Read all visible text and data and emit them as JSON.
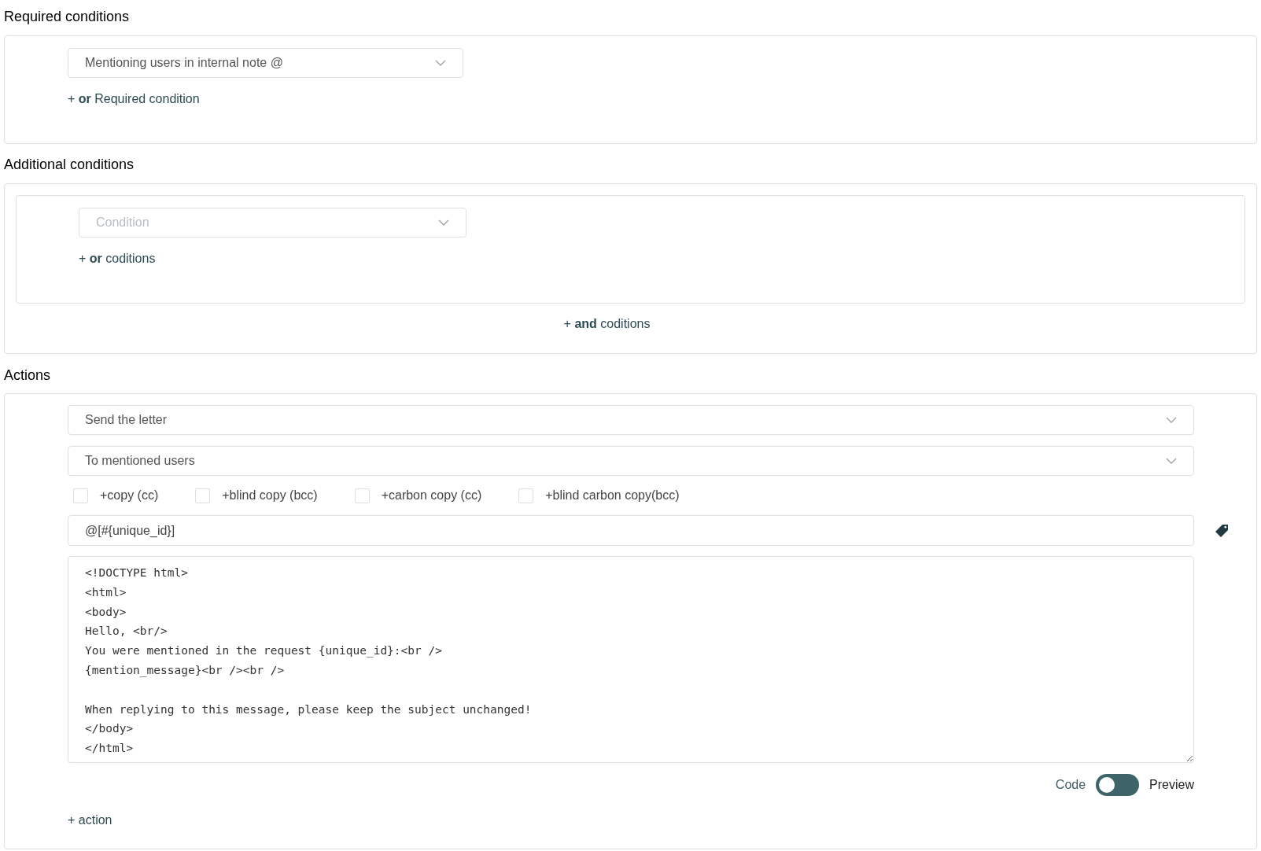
{
  "required_conditions": {
    "heading": "Required conditions",
    "select": {
      "value": "Mentioning users in internal note @"
    },
    "add_link": "+ **or** Required condition"
  },
  "additional_conditions": {
    "heading": "Additional conditions",
    "select": {
      "placeholder": "Condition"
    },
    "or_link": "+ **or** coditions",
    "and_link": "+ **and** coditions"
  },
  "actions": {
    "heading": "Actions",
    "action_select": {
      "value": "Send the letter"
    },
    "recipient_select": {
      "value": "To mentioned users"
    },
    "copy_options": [
      {
        "label": "+copy (cc)",
        "checked": false
      },
      {
        "label": "+blind copy (bcc)",
        "checked": false
      },
      {
        "label": "+carbon copy (cc)",
        "checked": false
      },
      {
        "label": "+blind carbon copy(bcc)",
        "checked": false
      }
    ],
    "subject": {
      "value": "@[#{unique_id}]"
    },
    "body": "<!DOCTYPE html>\n<html>\n<body>\nHello, <br/>\nYou were mentioned in the request {unique_id}:<br />\n{mention_message}<br /><br />\n\nWhen replying to this message, please keep the subject unchanged!\n</body>\n</html>",
    "mode_toggle": {
      "left_label": "Code",
      "right_label": "Preview",
      "on": false
    },
    "add_action": "+ action"
  }
}
